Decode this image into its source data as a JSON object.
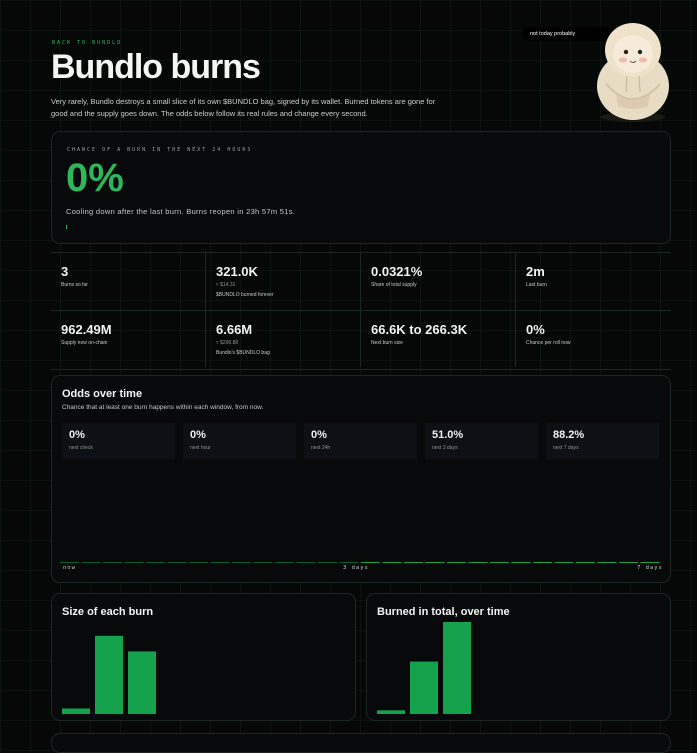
{
  "header": {
    "back_link": "BACK TO BUNDLO",
    "title": "Bundlo burns",
    "intro": "Very rarely, Bundlo destroys a small slice of its own $BUNDLO bag, signed by its wallet. Burned tokens are gone for good and the supply goes down. The odds below follow its real rules and change every second.",
    "bubble": "not today probably",
    "mascot_icon": "mascot-hoodie-figure"
  },
  "chance": {
    "label": "CHANCE OF A BURN IN THE NEXT 24 HOURS",
    "value": "0%",
    "status": "Cooling down after the last burn. Burns reopen in 23h 57m 51s.",
    "accent": "#2fb55a"
  },
  "stats": [
    {
      "value": "3",
      "label": "Burns so far"
    },
    {
      "value": "321.0K",
      "sub": "≈ $14.31",
      "label": "$BUNDLO burned forever"
    },
    {
      "value": "0.0321%",
      "label": "Share of total supply"
    },
    {
      "value": "2m",
      "label": "Last burn"
    },
    {
      "value": "962.49M",
      "label": "Supply now on-chain"
    },
    {
      "value": "6.66M",
      "sub": "≈ $296.88",
      "label": "Bundlo's $BUNDLO bag"
    },
    {
      "value": "66.6K to 266.3K",
      "label": "Next burn size"
    },
    {
      "value": "0%",
      "label": "Chance per roll now"
    }
  ],
  "odds": {
    "title": "Odds over time",
    "subtitle": "Chance that at least one burn happens within each window, from now.",
    "tiles": [
      {
        "pct": "0%",
        "window": "next check"
      },
      {
        "pct": "0%",
        "window": "next hour"
      },
      {
        "pct": "0%",
        "window": "next 24h"
      },
      {
        "pct": "51.0%",
        "window": "next 3 days"
      },
      {
        "pct": "88.2%",
        "window": "next 7 days"
      }
    ]
  },
  "charts": {
    "size_title": "Size of each burn",
    "total_title": "Burned in total, over time"
  },
  "chart_data": [
    {
      "type": "bar",
      "xlabels": [
        "now",
        "3 days",
        "7 days"
      ],
      "values": [
        0.3,
        0.3,
        0.3,
        0.3,
        0.3,
        0.3,
        0.3,
        0.3,
        0.3,
        0.3,
        0.3,
        0.3,
        0.3,
        0.3,
        0.3,
        0.3,
        0.3,
        0.3,
        0.3,
        0.3,
        0.3,
        0.3,
        0.3,
        0.3,
        0.3,
        0.3,
        0.3,
        0.3,
        0.3,
        0.3,
        0.3,
        0.3,
        0.3,
        0.3,
        0.3,
        0.3,
        0.3,
        0.3,
        0.3,
        0.3,
        0.3,
        0.3,
        0.3,
        0.3,
        0.3,
        0.3,
        0.3,
        0.3,
        0.3,
        0.3,
        0.3,
        0.3,
        0.3,
        0.3,
        0.3,
        0.3,
        0.3,
        0.3,
        0.3,
        0.3,
        0.3,
        0.3,
        0.3,
        0.3,
        0.3,
        0.3,
        0.3,
        0.3,
        0.3,
        0.3,
        0.3,
        0.3,
        0.3,
        0.3,
        0.3,
        0.3,
        0.3,
        0.3,
        0.3,
        0.3,
        0.3,
        0.3,
        0.3,
        0.3,
        0.3,
        0.3,
        0.3,
        0.3,
        0.3,
        0.3,
        0.3,
        0.3,
        0.3,
        0.3,
        0.3,
        0.3,
        0.3,
        0.3,
        0.3,
        0.3,
        0.3,
        0.3,
        0.3,
        0.3,
        0.3,
        0.3,
        0.3,
        0.3,
        0.3,
        0.3,
        0.3,
        0.3,
        0.3,
        0.3,
        0.3,
        0.3,
        0.3,
        0.3,
        0.3,
        0.3,
        0.3,
        0.3,
        0.3,
        0.3,
        0.3,
        0.3,
        0.3,
        0.3,
        0.3,
        0.3,
        0.3,
        0.3,
        0.3,
        0.3,
        0.3,
        0.3,
        0.3,
        0.3,
        0.3,
        0.3,
        0.3,
        0.3,
        0.3,
        0.3,
        0.3,
        0.3,
        0.3,
        0.3,
        0.3,
        0.3,
        0.3,
        0.3,
        0.3,
        0.3,
        0.3,
        0.3,
        0.3,
        0.3,
        0.3,
        0.3,
        0.3,
        0.3,
        0.3,
        0.3,
        0.3,
        0.3,
        0.3,
        0.3,
        0.3,
        0.3,
        0.3,
        0.3,
        0.3,
        0.3,
        0.3,
        0.3,
        0.3,
        0.3,
        0.3,
        0.3,
        0.3,
        0.3,
        0.3,
        0.3,
        0.3,
        0.3,
        0.3,
        0.3,
        0.3,
        0.3,
        0.3,
        0.3,
        0.3,
        0.3,
        0.3,
        0.3,
        0.3,
        0.3,
        0.3,
        0.3,
        0.3,
        0.3,
        0.3,
        0.3,
        0.3,
        0.3,
        0.3,
        0.3
      ],
      "ylim": [
        0,
        100
      ]
    },
    {
      "type": "bar",
      "values": [
        6,
        85,
        68
      ],
      "ylim": [
        0,
        100
      ]
    },
    {
      "type": "bar",
      "values": [
        4,
        57,
        100
      ],
      "ylim": [
        0,
        100
      ]
    }
  ]
}
